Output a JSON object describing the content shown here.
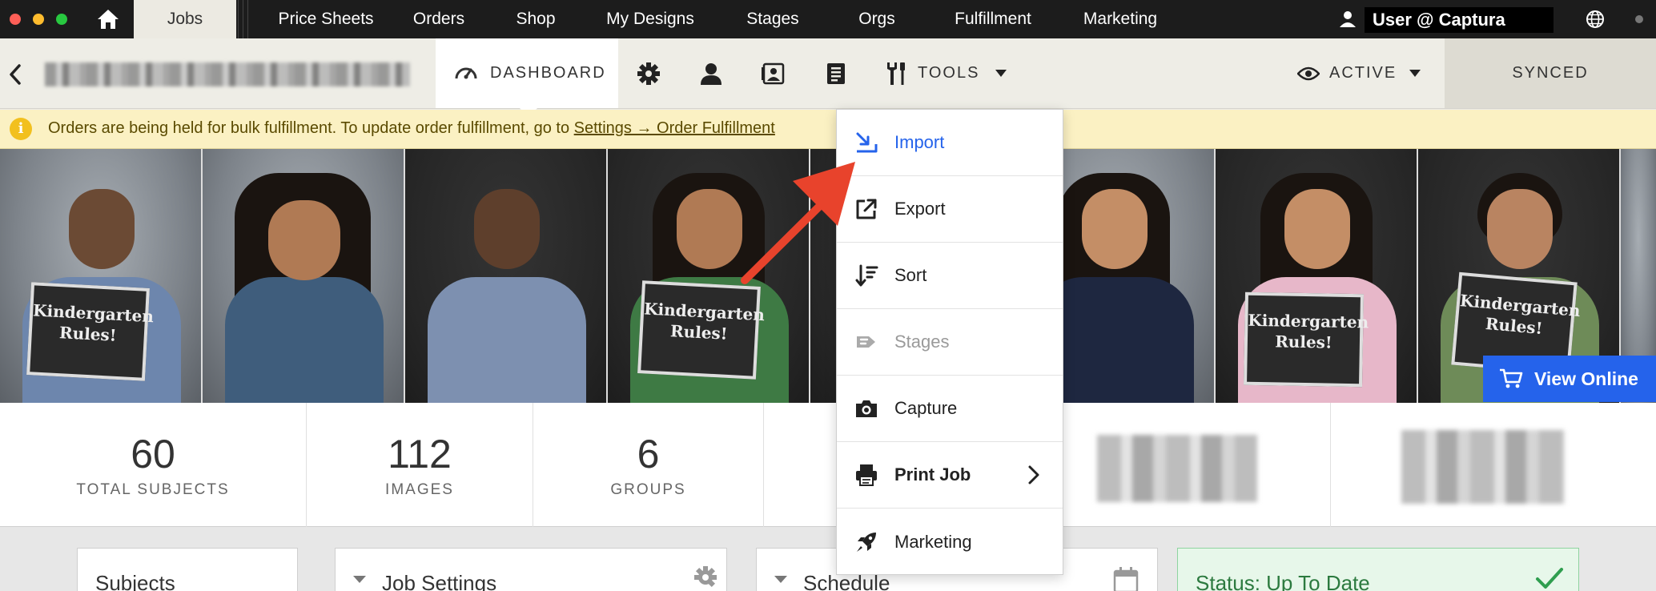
{
  "topbar": {
    "tabs": [
      "Jobs",
      "Price Sheets",
      "Orders",
      "Shop",
      "My Designs",
      "Stages",
      "Orgs",
      "Fulfillment",
      "Marketing"
    ],
    "user": "User @ Captura"
  },
  "subbar": {
    "dashboard_label": "DASHBOARD",
    "tools_label": "TOOLS",
    "active_label": "ACTIVE",
    "synced_label": "SYNCED"
  },
  "banner": {
    "text": "Orders are being held for bulk fulfillment. To update order fulfillment, go to ",
    "link": "Settings → Order Fulfillment"
  },
  "photos": {
    "sign_line1": "Kindergarten",
    "sign_line2": "Rules!",
    "view_online": "View Online"
  },
  "stats": [
    {
      "value": "60",
      "label": "TOTAL SUBJECTS"
    },
    {
      "value": "112",
      "label": "IMAGES"
    },
    {
      "value": "6",
      "label": "GROUPS"
    }
  ],
  "panels": {
    "subjects": "Subjects",
    "job_settings": "Job Settings",
    "schedule": "Schedule",
    "status": "Status: Up To Date"
  },
  "tools_menu": [
    {
      "label": "Import",
      "icon": "import-icon"
    },
    {
      "label": "Export",
      "icon": "export-icon"
    },
    {
      "label": "Sort",
      "icon": "sort-icon"
    },
    {
      "label": "Stages",
      "icon": "stages-icon"
    },
    {
      "label": "Capture",
      "icon": "camera-icon"
    },
    {
      "label": "Print Job",
      "icon": "printer-icon"
    },
    {
      "label": "Marketing",
      "icon": "rocket-icon"
    }
  ],
  "colors": {
    "accent_blue": "#2563eb",
    "annotation_red": "#e8432c",
    "banner_yellow": "#fbf1c3"
  }
}
